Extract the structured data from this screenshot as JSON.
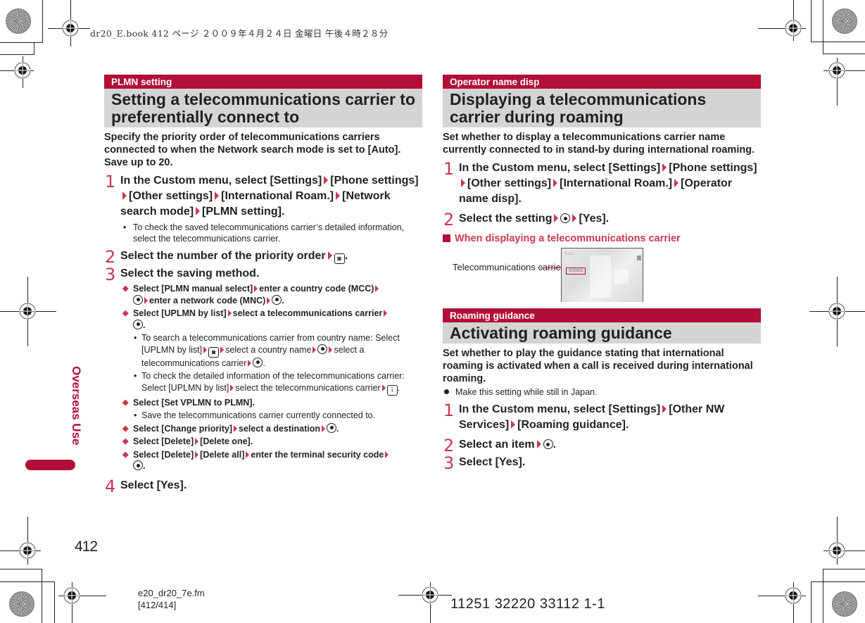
{
  "header": {
    "running_head": "dr20_E.book   412 ページ   ２００９年４月２４日   金曜日   午後４時２８分"
  },
  "side": {
    "chapter_tab": "Overseas Use",
    "page_number": "412",
    "accent_color": "#b20e37"
  },
  "left": {
    "label": "PLMN setting",
    "title": "Setting a telecommunications carrier to preferentially connect to",
    "intro": "Specify the priority order of telecommunications carriers connected to when the Network search mode is set to [Auto]. Save up to 20.",
    "steps": [
      {
        "num": "1",
        "parts": [
          "In the Custom menu, select [Settings]",
          "[Phone settings]",
          "[Other settings]",
          "[International Roam.]",
          "[Network search mode]",
          "[PLMN setting]."
        ]
      },
      {
        "num": "2",
        "text": "Select the number of the priority order",
        "key": "camera-key"
      },
      {
        "num": "3",
        "text": "Select the saving method."
      },
      {
        "num": "4",
        "text": "Select [Yes]."
      }
    ],
    "step1_note": "To check the saved telecommunications carrier’s detailed information, select the telecommunications carrier.",
    "options": [
      {
        "parts": [
          "Select [PLMN manual select]",
          "enter a country code (MCC)",
          "",
          "enter a network code (MNC)",
          "."
        ]
      },
      {
        "parts": [
          "Select [UPLMN by list]",
          "select a telecommunications carrier",
          "."
        ]
      },
      {
        "text": "Select [Set VPLMN to PLMN]."
      },
      {
        "parts": [
          "Select [Change priority]",
          "select a destination",
          "."
        ]
      },
      {
        "parts": [
          "Select [Delete]",
          "[Delete one]."
        ]
      },
      {
        "parts": [
          "Select [Delete]",
          "[Delete all]",
          "enter the terminal security code",
          "."
        ]
      }
    ],
    "subnotes": {
      "uplmn_search": [
        "To search a telecommunications carrier from country name: Select [UPLMN by list]",
        "select a country name",
        "select a telecommunications carrier",
        "."
      ],
      "uplmn_detail": [
        "To check the detailed information of the telecommunications carrier: Select [UPLMN by list]",
        "select the telecommunications carrier",
        "."
      ],
      "vplmn": "Save the telecommunications carrier currently connected to."
    }
  },
  "right": {
    "operator": {
      "label": "Operator name disp",
      "title": "Displaying a telecommunications carrier during roaming",
      "intro": "Set whether to display a telecommunications carrier name currently connected to in stand-by during international roaming.",
      "step1": [
        "In the Custom menu, select [Settings]",
        "[Phone settings]",
        "[Other settings]",
        "[International Roam.]",
        "[Operator name disp]."
      ],
      "step2": [
        "Select the setting",
        "[Yes]."
      ],
      "subhead": "When displaying a telecommunications carrier",
      "figure_label": "Telecommunications carrier name",
      "figure_placeholder": "XXXXXX"
    },
    "roaming": {
      "label": "Roaming guidance",
      "title": "Activating roaming guidance",
      "intro": "Set whether to play the guidance stating that international roaming is activated when a call is received during international roaming.",
      "note": "Make this setting while still in Japan.",
      "step1": [
        "In the Custom menu, select [Settings]",
        "[Other NW Services]",
        "[Roaming guidance]."
      ],
      "step2": [
        "Select an item",
        "."
      ],
      "step3": "Select [Yes]."
    }
  },
  "footer": {
    "file": "e20_dr20_7e.fm",
    "pages": "[412/414]",
    "code": "11251 32220 33112 1-1"
  }
}
